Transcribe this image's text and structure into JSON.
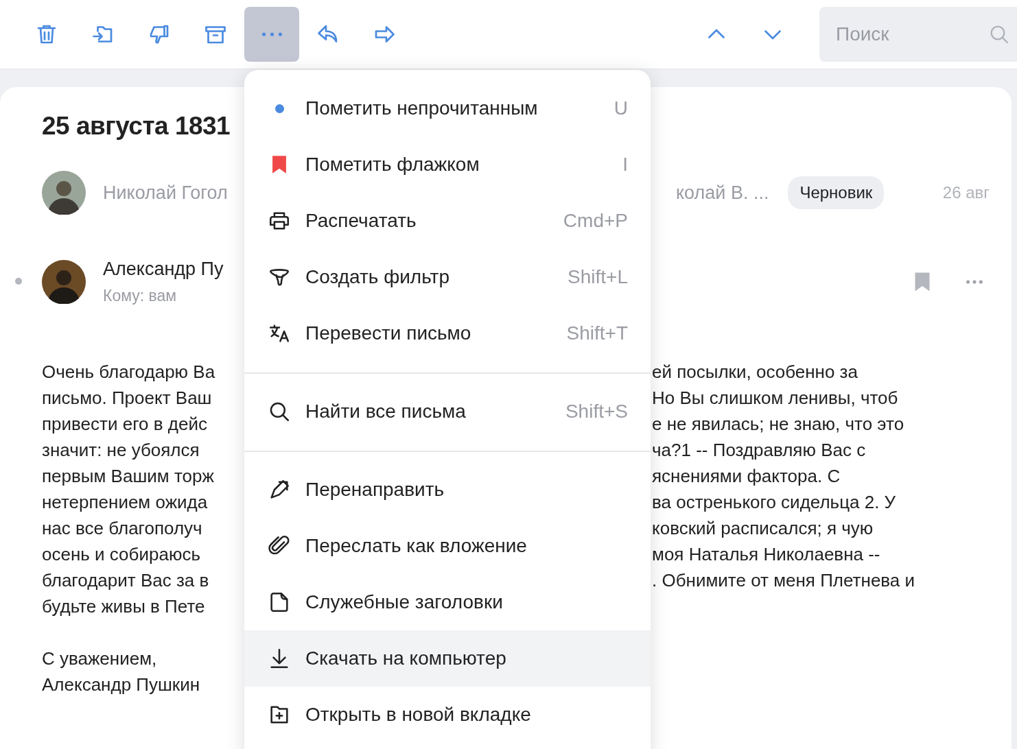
{
  "toolbar": {
    "buttons": [
      {
        "kind": "trash",
        "selected": false
      },
      {
        "kind": "move",
        "selected": false
      },
      {
        "kind": "spam",
        "selected": false
      },
      {
        "kind": "archive",
        "selected": false
      },
      {
        "kind": "more",
        "selected": true
      },
      {
        "kind": "reply",
        "selected": false
      },
      {
        "kind": "forward",
        "selected": false
      }
    ],
    "nav": [
      {
        "kind": "up"
      },
      {
        "kind": "down"
      }
    ],
    "search": {
      "placeholder": "Поиск"
    }
  },
  "letter": {
    "title": "25 августа 1831",
    "thread": {
      "sender_visible_left": "Николай Гогол",
      "sender_visible_right": "колай В. ...",
      "badge": "Черновик",
      "date": "26 авг"
    },
    "message": {
      "sender": "Александр Пу",
      "to": "Кому: вам",
      "unread": true,
      "flagged": false
    },
    "body": [
      {
        "left": "Очень благодарю Ва",
        "right": "ей посылки, особенно за"
      },
      {
        "left": "письмо. Проект Ваш",
        "right": "Но Вы слишком ленивы, чтоб"
      },
      {
        "left": "привести его в дейс",
        "right": "е не явилась; не знаю, что это"
      },
      {
        "left": "значит: не убоялся",
        "right": "ча?1 -- Поздравляю Вас с"
      },
      {
        "left": "первым Вашим торж",
        "right": "яснениями фактора. С"
      },
      {
        "left": "нетерпением ожида",
        "right": "ва остренького сидельца 2. У"
      },
      {
        "left": "нас все благополуч",
        "right": "ковский расписался; я чую"
      },
      {
        "left": "осень и собираюсь",
        "right": "моя Наталья Николаевна --"
      },
      {
        "left": "благодарит Вас за в",
        "right": ". Обнимите от меня Плетнева и"
      },
      {
        "left": "будьте живы в Пете"
      }
    ],
    "signature": [
      "С уважением,",
      "Александр Пушкин"
    ]
  },
  "menu": {
    "groups": [
      {
        "items": [
          {
            "kind": "dot",
            "label": "Пометить непрочитанным",
            "shortcut": "U",
            "selected": false
          },
          {
            "kind": "flag",
            "label": "Пометить флажком",
            "shortcut": "I",
            "selected": false
          },
          {
            "kind": "print",
            "label": "Распечатать",
            "shortcut": "Cmd+P",
            "selected": false
          },
          {
            "kind": "filter",
            "label": "Создать фильтр",
            "shortcut": "Shift+L",
            "selected": false
          },
          {
            "kind": "translate",
            "label": "Перевести письмо",
            "shortcut": "Shift+T",
            "selected": false
          }
        ]
      },
      {
        "items": [
          {
            "kind": "search",
            "label": "Найти все письма",
            "shortcut": "Shift+S",
            "selected": false
          }
        ]
      },
      {
        "items": [
          {
            "kind": "redirect",
            "label": "Перенаправить",
            "selected": false
          },
          {
            "kind": "attach",
            "label": "Переслать как вложение",
            "selected": false
          },
          {
            "kind": "headers",
            "label": "Служебные заголовки",
            "selected": false
          },
          {
            "kind": "download",
            "label": "Скачать на компьютер",
            "selected": true
          },
          {
            "kind": "newtab",
            "label": "Открыть в новой вкладке",
            "selected": false
          }
        ]
      }
    ]
  }
}
